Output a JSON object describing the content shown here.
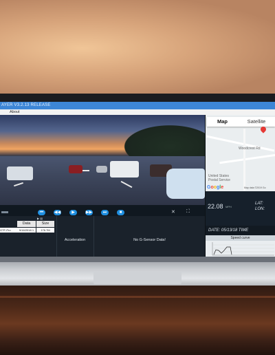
{
  "window": {
    "title": "AYER V3.2.13 RELEASE"
  },
  "menu": {
    "about": "About"
  },
  "map": {
    "tabs": [
      "Map",
      "Satellite"
    ],
    "labels": [
      "Woodcrest Rd",
      "United States",
      "Postal Service"
    ],
    "logo": "Google",
    "copyright": "Map data ©2019 Go"
  },
  "telemetry": {
    "speed": "22.08",
    "speed_unit": "MPH",
    "lat_label": "LAT:",
    "lon_label": "LON:",
    "date_label": "DATE: 05/13/18  TIME"
  },
  "controls": {
    "buttons": [
      "⏮",
      "◀◀",
      "▶",
      "▶▶",
      "⏭",
      "■"
    ],
    "close": "✕",
    "fullscreen": "⛶"
  },
  "file_table": {
    "headers": [
      "Data",
      "Size"
    ],
    "rows": [
      [
        "GTF-Pro",
        "9/16/2018 1",
        "176.7M"
      ]
    ],
    "nav_icons": "▶  ▤"
  },
  "panels": {
    "acceleration": "Acceleration",
    "gsensor": "No G-Sensor Data!"
  },
  "speed_curve": {
    "title": "Speed curve"
  }
}
